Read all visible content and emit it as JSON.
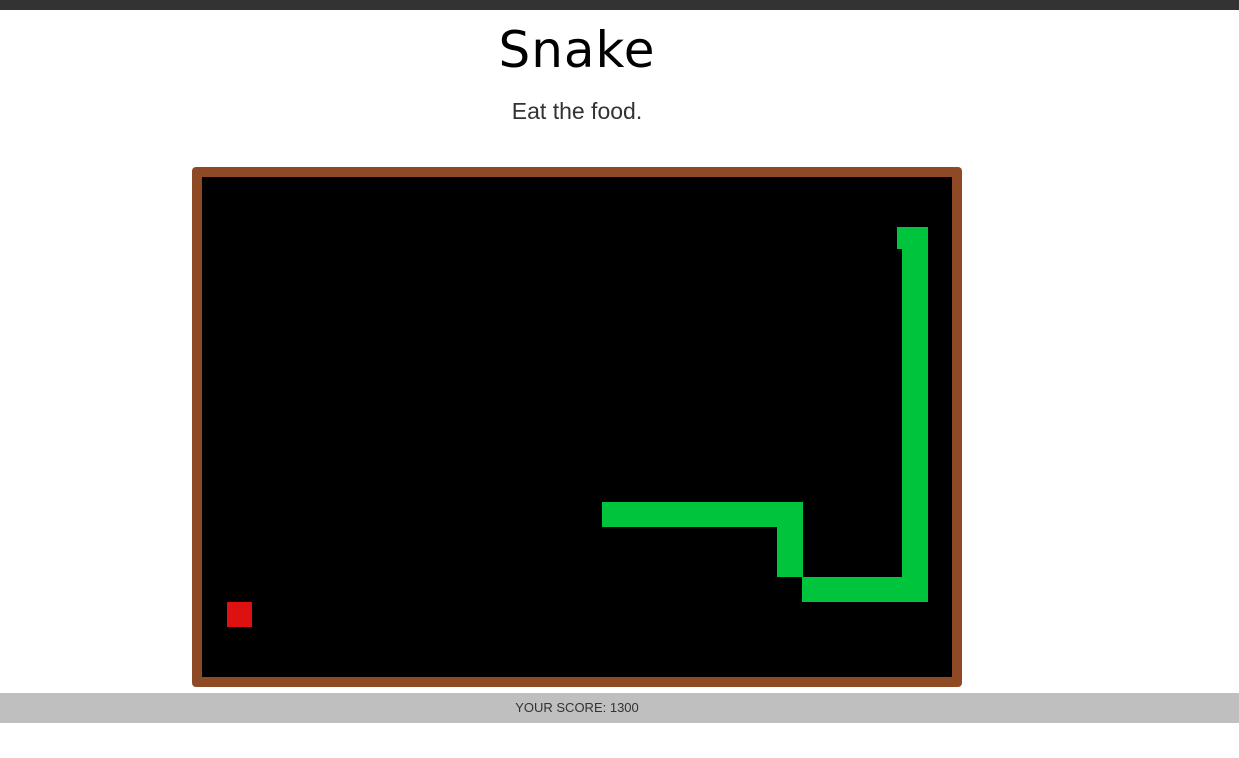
{
  "page": {
    "title": "Snake",
    "subtitle": "Eat the food."
  },
  "board": {
    "grid_cols": 30,
    "grid_rows": 20,
    "colors": {
      "frame": "#8e4a25",
      "background": "#000000",
      "snake": "#00c43c",
      "food": "#dd1111"
    },
    "snake_cells": [
      [
        16,
        13
      ],
      [
        17,
        13
      ],
      [
        18,
        13
      ],
      [
        19,
        13
      ],
      [
        20,
        13
      ],
      [
        21,
        13
      ],
      [
        22,
        13
      ],
      [
        23,
        13
      ],
      [
        23,
        14
      ],
      [
        23,
        15
      ],
      [
        24,
        16
      ],
      [
        25,
        16
      ],
      [
        26,
        16
      ],
      [
        27,
        16
      ],
      [
        28,
        16
      ],
      [
        28,
        15
      ],
      [
        28,
        14
      ],
      [
        28,
        13
      ],
      [
        28,
        12
      ],
      [
        28,
        11
      ],
      [
        28,
        10
      ],
      [
        28,
        9
      ],
      [
        28,
        8
      ],
      [
        28,
        7
      ],
      [
        28,
        6
      ],
      [
        28,
        5
      ],
      [
        28,
        4
      ],
      [
        28,
        3
      ],
      [
        28,
        2
      ]
    ],
    "food_cell": [
      1,
      17
    ]
  },
  "score": {
    "label": "YOUR SCORE: 1300"
  }
}
